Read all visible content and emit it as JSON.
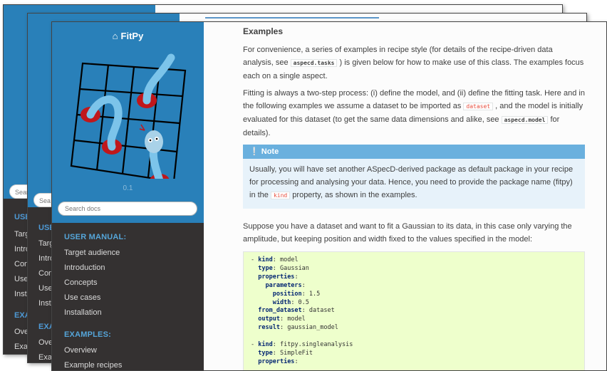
{
  "app": {
    "brand": "FitPy",
    "version": "0.1",
    "search_placeholder": "Search docs",
    "stack_search_placeholder": "Searc",
    "stack_search_placeholder2": "Sea"
  },
  "sidebar": {
    "captions": [
      "USER MANUAL:",
      "EXAMPLES:"
    ],
    "user_manual": [
      "Target audience",
      "Introduction",
      "Concepts",
      "Use cases",
      "Installation"
    ],
    "examples": [
      "Overview",
      "Example recipes"
    ]
  },
  "stack1": {
    "caption1": "USE",
    "items": [
      "Targ",
      "Intro",
      "Con",
      "Use",
      "Insta"
    ],
    "caption2": "EXA",
    "items2": [
      "Ove",
      "Exar"
    ]
  },
  "stack2": {
    "caption1": "USE",
    "items": [
      "Targ",
      "Intro",
      "Con",
      "Use",
      "Insta"
    ],
    "caption2": "EXA",
    "items2": [
      "Ove",
      "Exar"
    ]
  },
  "content": {
    "heading": "Examples",
    "p1_a": "For convenience, a series of examples in recipe style (for details of the recipe-driven data analysis, see ",
    "p1_code": "aspecd.tasks",
    "p1_b": " ) is given below for how to make use of this class. The examples focus each on a single aspect.",
    "p2_a": "Fitting is always a two-step process: (i) define the model, and (ii) define the fitting task. Here and in the following examples we assume a dataset to be imported as ",
    "p2_code1": "dataset",
    "p2_b": " , and the model is initially evaluated for this dataset (to get the same data dimensions and alike, see ",
    "p2_code2": "aspecd.model",
    "p2_c": " for details).",
    "note_title": "Note",
    "note_a": "Usually, you will have set another ASpecD-derived package as default package in your recipe for processing and analysing your data. Hence, you need to provide the package name (fitpy) in the ",
    "note_code": "kind",
    "note_b": " property, as shown in the examples.",
    "p3": "Suppose you have a dataset and want to fit a Gaussian to its data, in this case only varying the amplitude, but keeping position and width fixed to the values specified in the model:"
  },
  "code_block": [
    {
      "indent": "- ",
      "key": "kind",
      "value": " model"
    },
    {
      "indent": "  ",
      "key": "type",
      "value": " Gaussian"
    },
    {
      "indent": "  ",
      "key": "properties",
      "value": ""
    },
    {
      "indent": "    ",
      "key": "parameters",
      "value": ""
    },
    {
      "indent": "      ",
      "key": "position",
      "value": " 1.5"
    },
    {
      "indent": "      ",
      "key": "width",
      "value": " 0.5"
    },
    {
      "indent": "  ",
      "key": "from_dataset",
      "value": " dataset"
    },
    {
      "indent": "  ",
      "key": "output",
      "value": " model"
    },
    {
      "indent": "  ",
      "key": "result",
      "value": " gaussian_model"
    },
    {
      "indent": "",
      "key": "",
      "value": ""
    },
    {
      "indent": "- ",
      "key": "kind",
      "value": " fitpy.singleanalysis"
    },
    {
      "indent": "  ",
      "key": "type",
      "value": " SimpleFit"
    },
    {
      "indent": "  ",
      "key": "properties",
      "value": ""
    }
  ],
  "colors": {
    "sidebar_blue": "#2980b9",
    "sidebar_dark": "#343131",
    "note_header": "#6ab0de",
    "note_body": "#e7f2fa",
    "code_bg": "#eeffcc"
  }
}
